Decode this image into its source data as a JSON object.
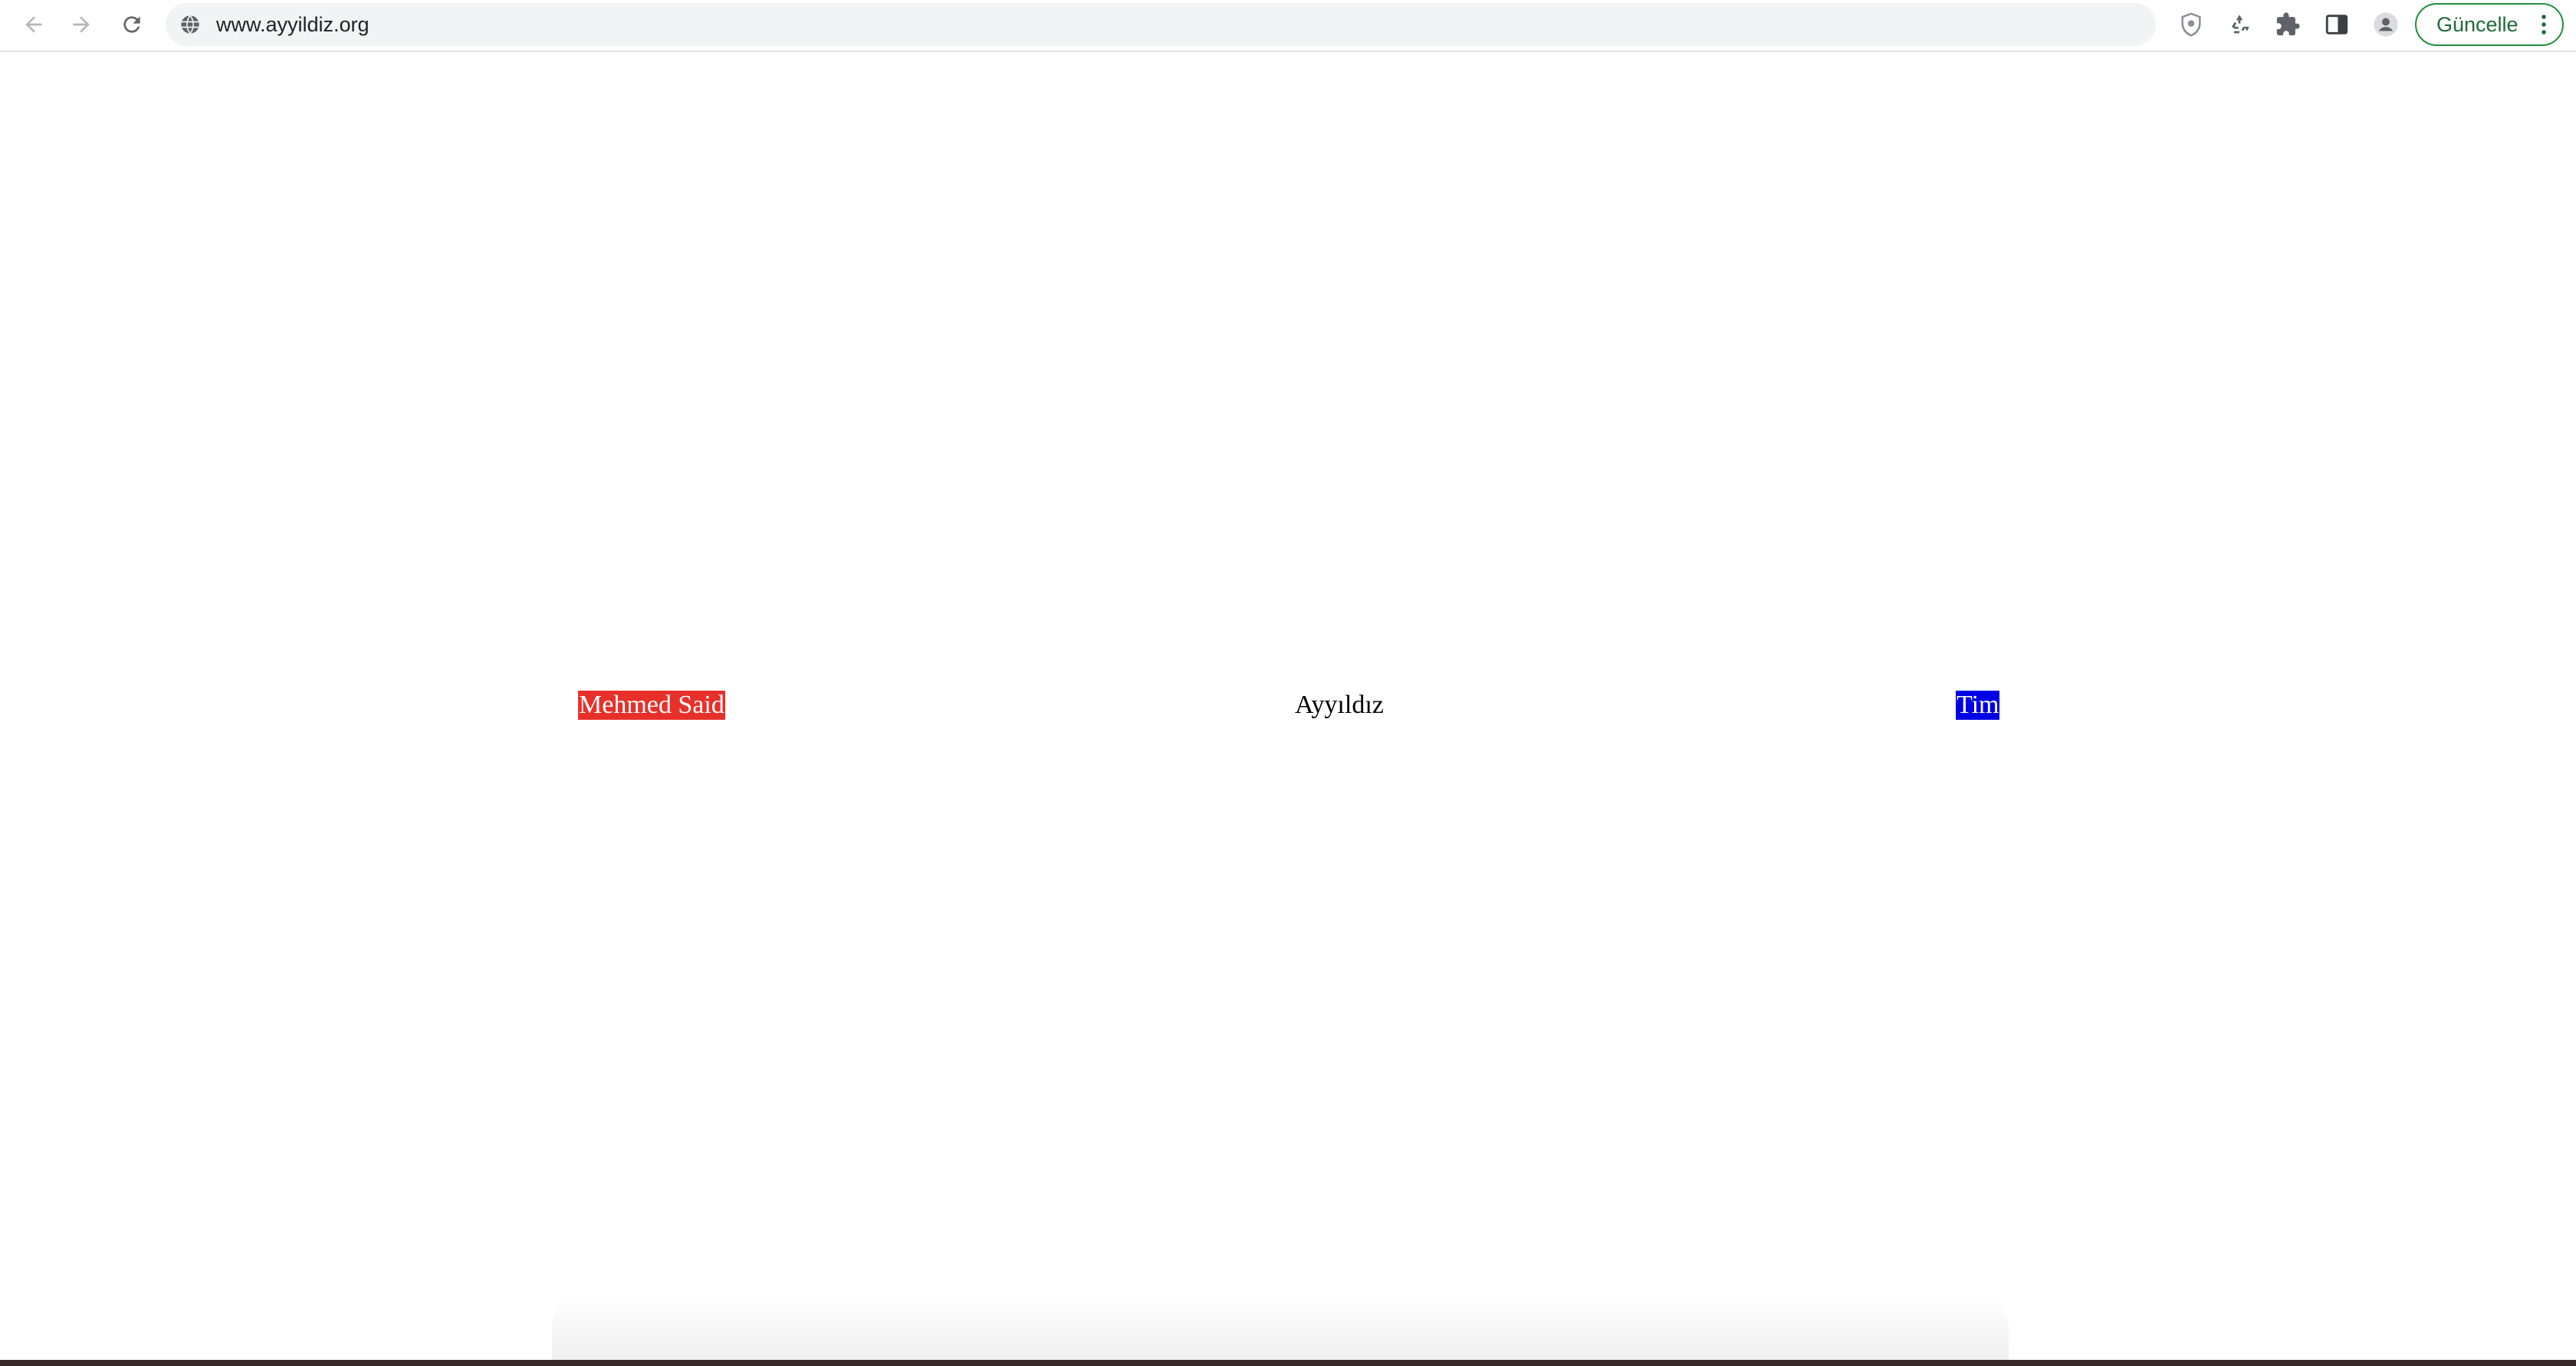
{
  "browser": {
    "url": "www.ayyildiz.org",
    "update_button_label": "Güncelle",
    "icons": [
      "back-arrow-icon",
      "forward-arrow-icon",
      "reload-icon",
      "globe-icon",
      "shield-extension-icon",
      "recycle-extension-icon",
      "puzzle-extensions-icon",
      "side-panel-icon",
      "profile-avatar-icon",
      "kebab-menu-icon"
    ]
  },
  "page": {
    "words": [
      {
        "text": "Mehmed Said",
        "background": "#e8302a",
        "color": "#ffffff"
      },
      {
        "text": "Ayyıldız",
        "background": "#ffffff",
        "color": "#000000"
      },
      {
        "text": "Tim",
        "background": "#0000e6",
        "color": "#ffffff"
      }
    ]
  }
}
